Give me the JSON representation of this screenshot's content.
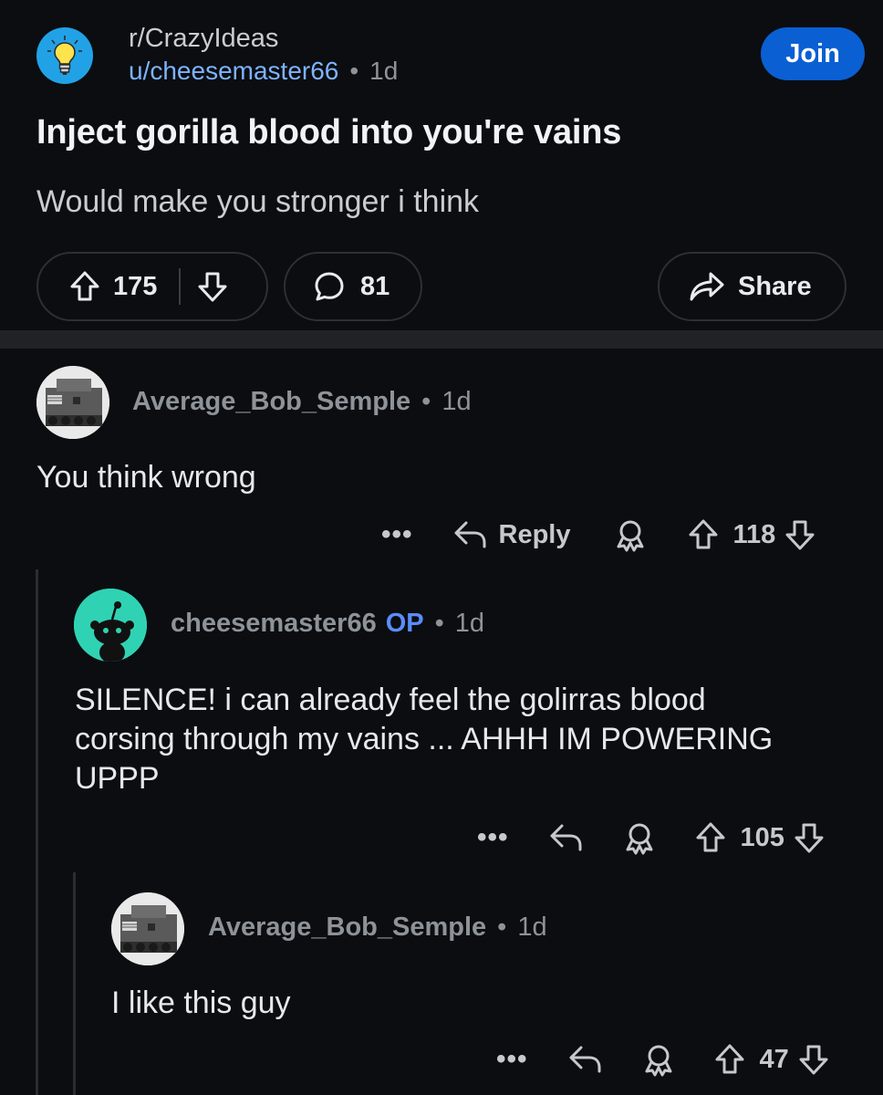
{
  "post": {
    "subreddit": "r/CrazyIdeas",
    "author": "u/cheesemaster66",
    "age": "1d",
    "join_label": "Join",
    "title": "Inject gorilla blood into you're vains",
    "body": "Would make you stronger i think",
    "upvotes": "175",
    "comments": "81",
    "share_label": "Share"
  },
  "comments": [
    {
      "user": "Average_Bob_Semple",
      "age": "1d",
      "text": "You think wrong",
      "reply_label": "Reply",
      "score": "118"
    },
    {
      "user": "cheesemaster66",
      "op_label": "OP",
      "age": "1d",
      "text_lines": [
        "SILENCE! i can already feel the golirras blood",
        "corsing through my vains ... AHHH IM POWERING",
        "UPPP"
      ],
      "score": "105"
    },
    {
      "user": "Average_Bob_Semple",
      "age": "1d",
      "text": "I like this guy",
      "score": "47"
    }
  ],
  "more_label": "•••",
  "colors": {
    "background": "#0b0d10",
    "join_button": "#0a5fd3",
    "username_link": "#7db3ff",
    "op_badge": "#5b8cff",
    "subreddit_icon": "#22a2e6",
    "snoo_avatar": "#2fd3b4"
  },
  "icons": [
    "lightbulb-icon",
    "upvote-icon",
    "downvote-icon",
    "comment-icon",
    "share-icon",
    "reply-icon",
    "award-icon",
    "more-icon"
  ]
}
